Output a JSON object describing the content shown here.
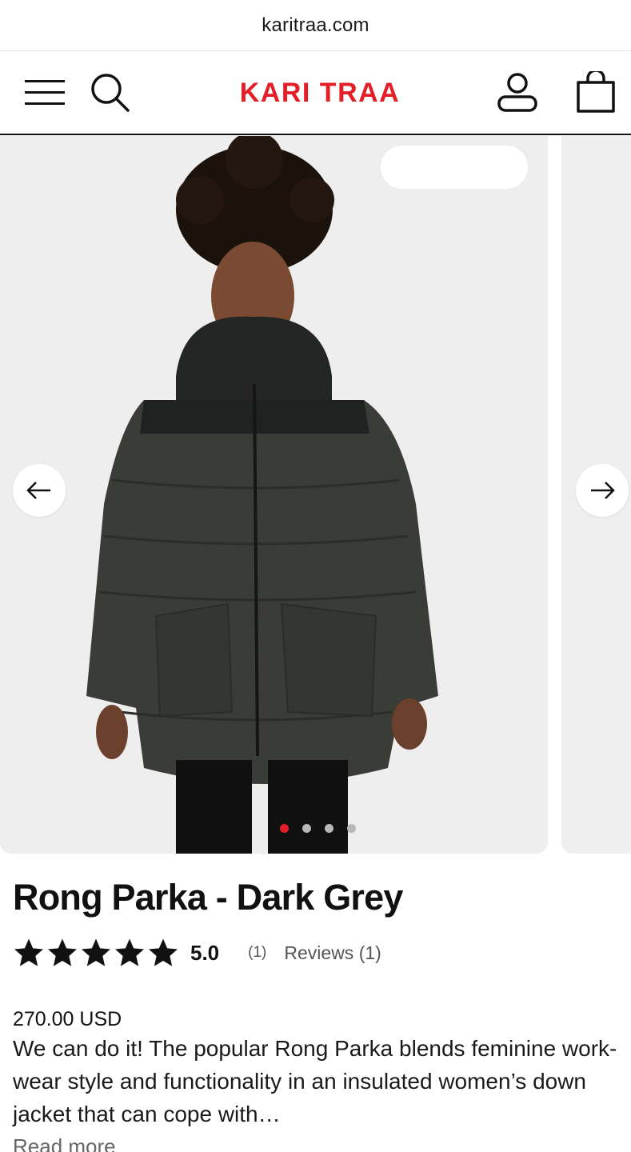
{
  "browser": {
    "url": "karitraa.com"
  },
  "header": {
    "brand": "KARI TRAA",
    "colors": {
      "brand": "#e41e26",
      "border": "#111111"
    },
    "icons": [
      "menu-icon",
      "search-icon",
      "account-icon",
      "cart-icon"
    ]
  },
  "gallery": {
    "slide_count": 4,
    "active_index": 0,
    "icons": [
      "arrow-left-icon",
      "arrow-right-icon"
    ],
    "colors": {
      "active_dot": "#e41e26",
      "inactive_dot": "#b8b8b8",
      "slide_bg": "#eeeeef"
    }
  },
  "product": {
    "title": "Rong Parka - Dark Grey",
    "rating": {
      "stars": 5,
      "value": "5.0",
      "count": "(1)",
      "reviews_label": "Reviews (1)"
    },
    "price": "270.00 USD",
    "description": "We can do it! The popular Rong Parka blends feminine work-wear style and functionality in an insulated women’s down jacket that can cope with…",
    "read_more": "Read more"
  }
}
